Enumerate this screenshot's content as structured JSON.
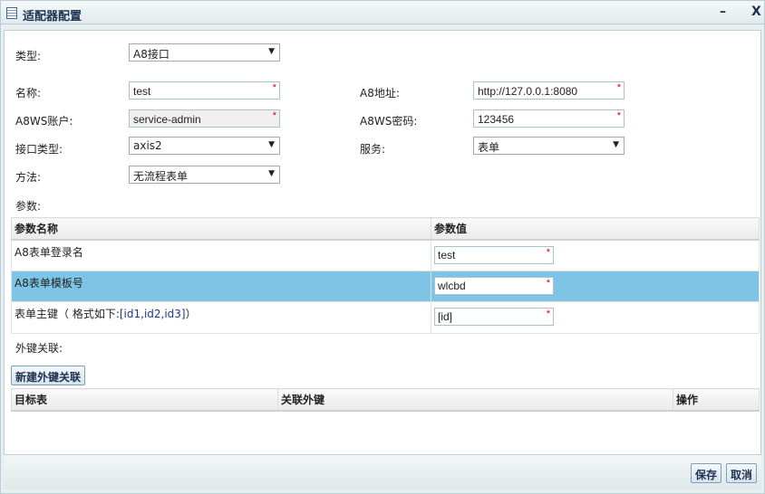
{
  "window": {
    "title": "适配器配置",
    "minimize": "–",
    "close": "X"
  },
  "form": {
    "type_label": "类型:",
    "type_value": "A8接口",
    "name_label": "名称:",
    "name_value": "test",
    "a8addr_label": "A8地址:",
    "a8addr_value": "http://127.0.0.1:8080",
    "account_label": "A8WS账户:",
    "account_value": "service-admin",
    "password_label": "A8WS密码:",
    "password_value": "123456",
    "iftype_label": "接口类型:",
    "iftype_value": "axis2",
    "service_label": "服务:",
    "service_value": "表单",
    "method_label": "方法:",
    "method_value": "无流程表单",
    "params_label": "参数:",
    "required_mark": "*",
    "dropdown_arrow": "▼"
  },
  "params_table": {
    "headers": [
      "参数名称",
      "参数值"
    ],
    "rows": [
      {
        "name": "A8表单登录名",
        "value": "test"
      },
      {
        "name": "A8表单模板号",
        "value": "wlcbd"
      },
      {
        "name_prefix": "表单主键（ 格式如下:",
        "name_example": "[id1,id2,id3]",
        "name_suffix": "）",
        "value": "[id]"
      }
    ]
  },
  "fk": {
    "label": "外键关联:",
    "new_button": "新建外键关联",
    "headers": [
      "目标表",
      "关联外键",
      "操作"
    ]
  },
  "footer": {
    "save": "保存",
    "cancel": "取消"
  }
}
